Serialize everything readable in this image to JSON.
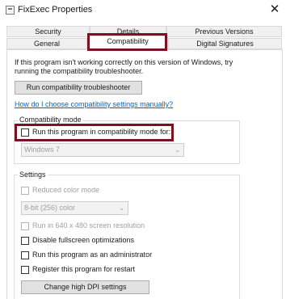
{
  "window": {
    "title": "FixExec Properties",
    "close_glyph": "✕"
  },
  "tabs": {
    "row1": [
      "Security",
      "Details",
      "Previous Versions"
    ],
    "row2": [
      "General",
      "Compatibility",
      "Digital Signatures"
    ],
    "active": "Compatibility"
  },
  "intro": {
    "line1": "If this program isn't working correctly on this version of Windows, try",
    "line2": "running the compatibility troubleshooter."
  },
  "troubleshooter_button": "Run compatibility troubleshooter",
  "help_link": "How do I choose compatibility settings manually?",
  "compat_mode": {
    "legend": "Compatibility mode",
    "checkbox_label": "Run this program in compatibility mode for:",
    "checked": false,
    "os_value": "Windows 7"
  },
  "settings": {
    "legend": "Settings",
    "reduced_color": "Reduced color mode",
    "color_value": "8-bit (256) color",
    "resolution": "Run in 640 x 480 screen resolution",
    "fullscreen": "Disable fullscreen optimizations",
    "admin": "Run this program as an administrator",
    "restart": "Register this program for restart",
    "dpi_button": "Change high DPI settings"
  },
  "colors": {
    "highlight": "#7b1223",
    "link": "#0066cc"
  }
}
